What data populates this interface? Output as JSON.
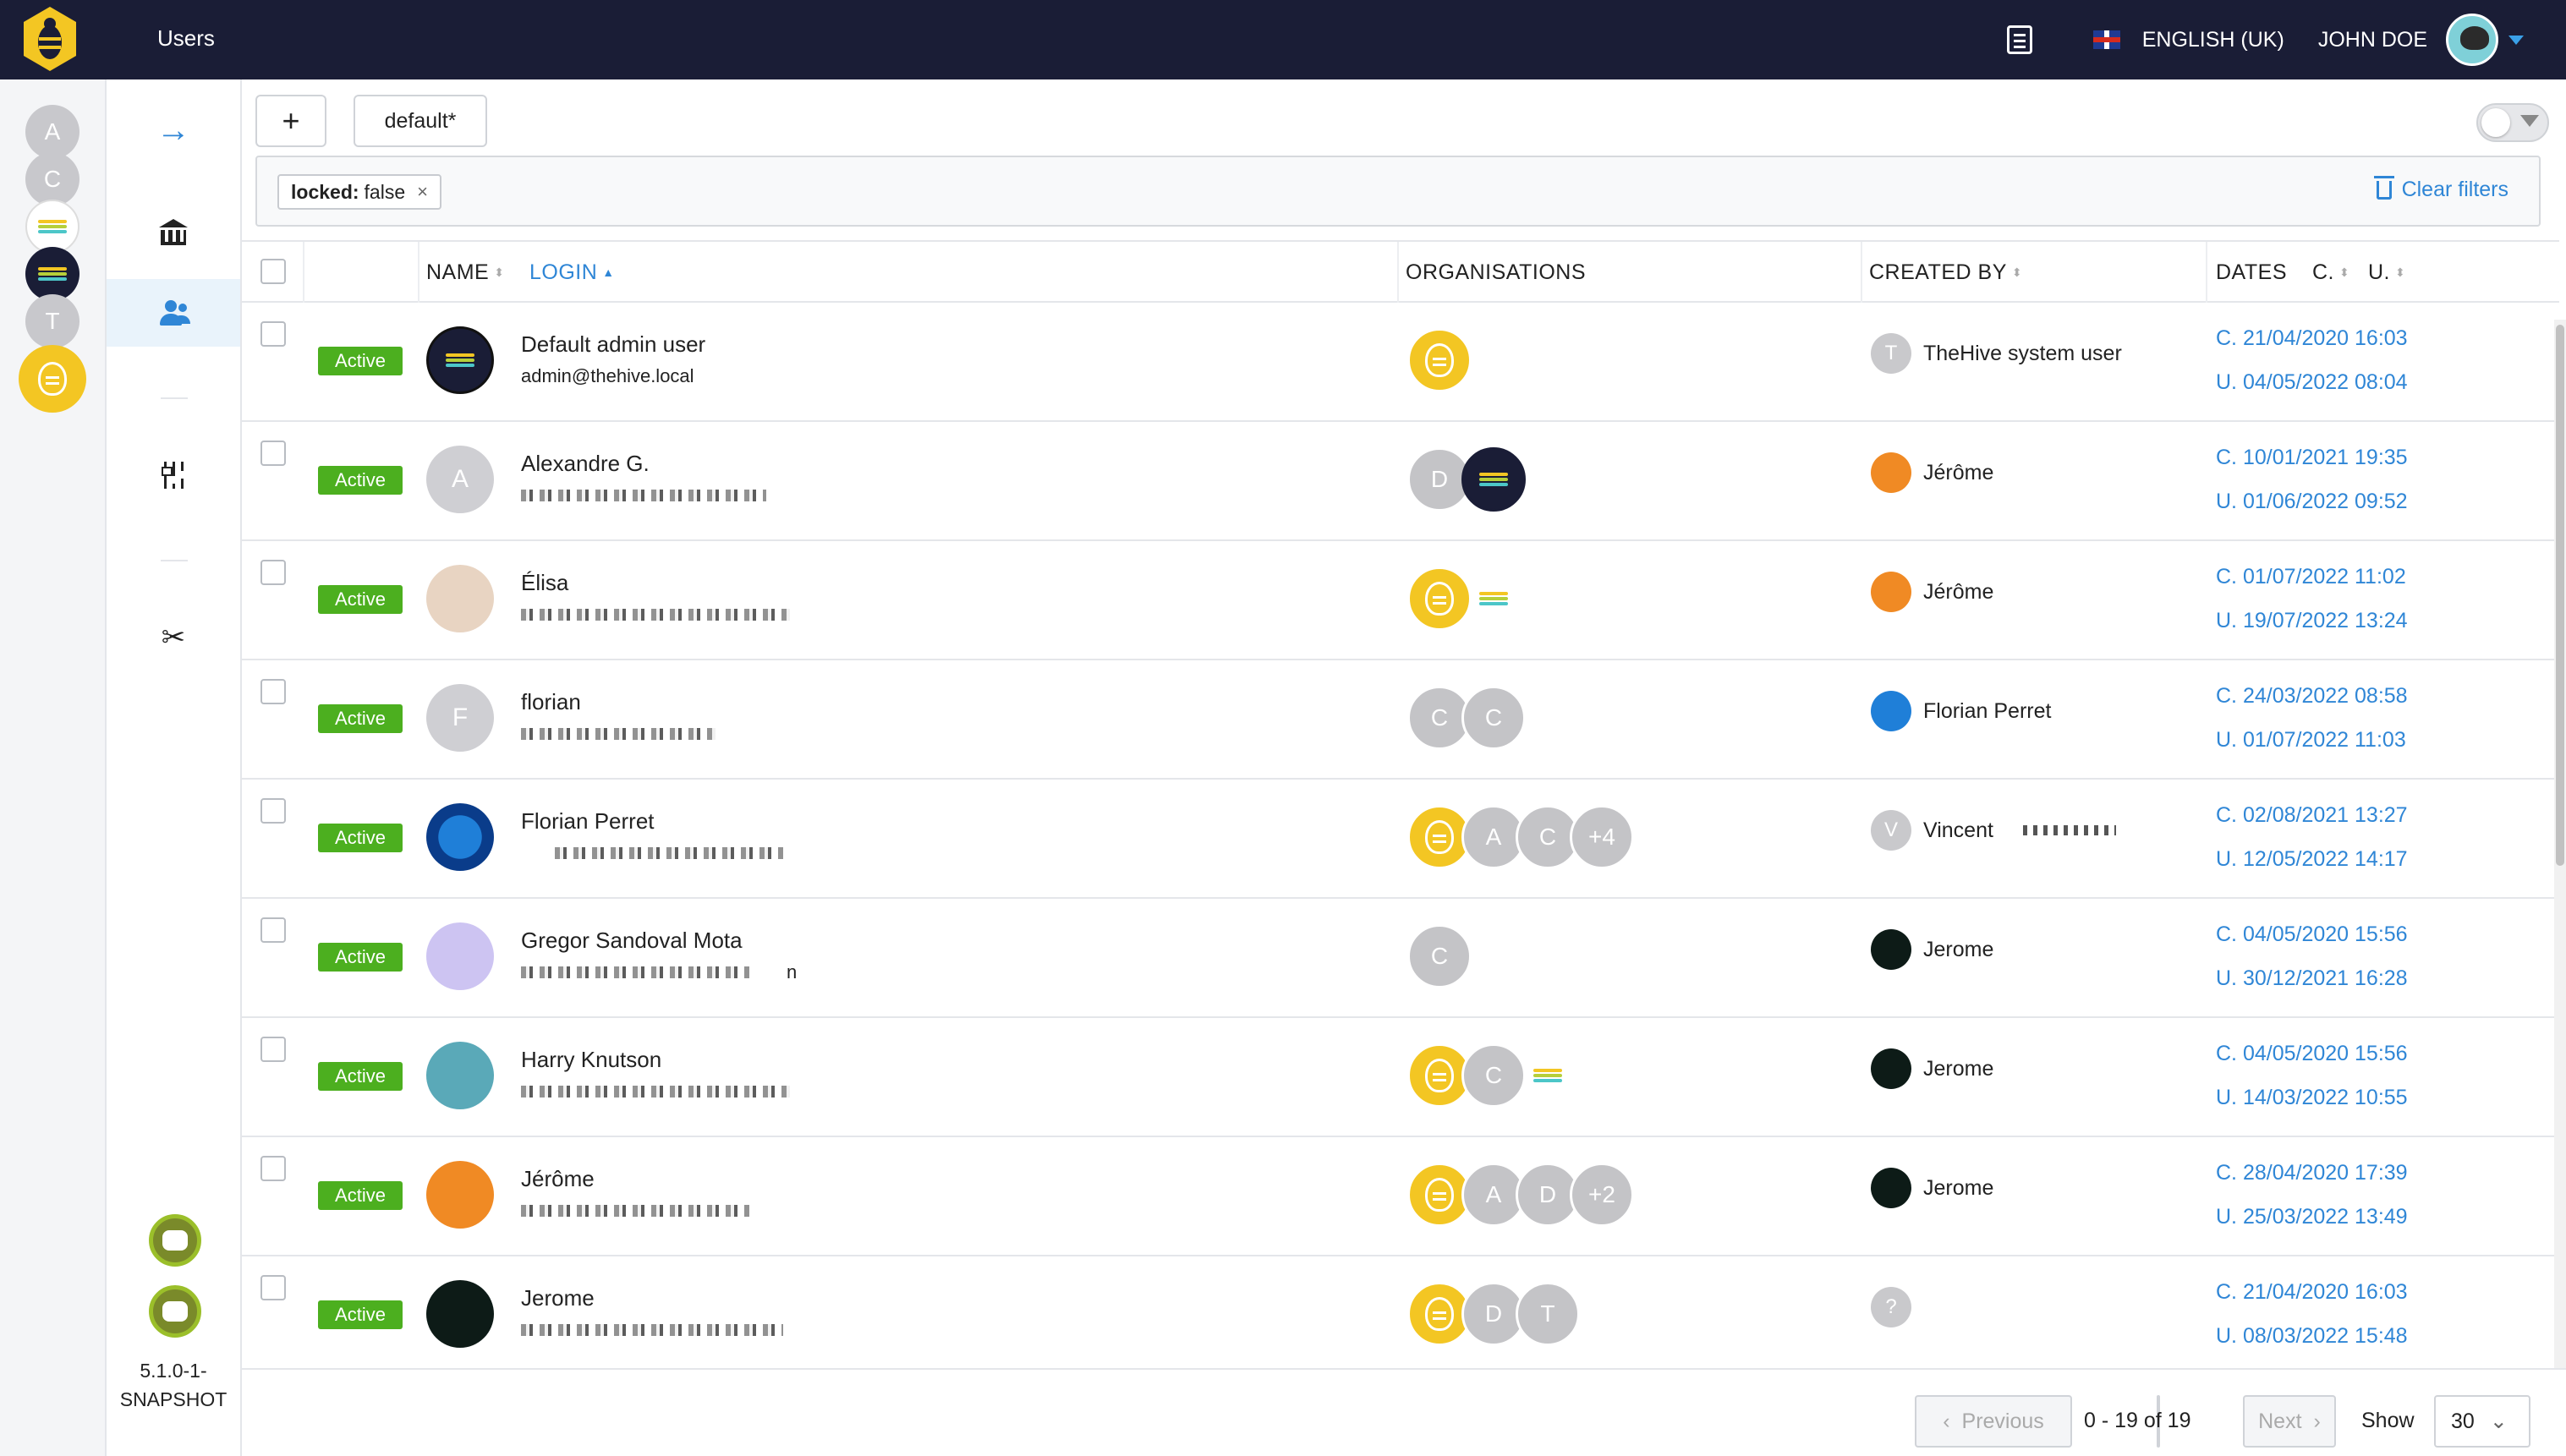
{
  "topbar": {
    "title": "Users",
    "language": "ENGLISH (UK)",
    "user": "JOHN DOE"
  },
  "rail": {
    "orgs": [
      "A",
      "C",
      "",
      "",
      "T",
      ""
    ]
  },
  "version": [
    "5.1.0-1-",
    "SNAPSHOT"
  ],
  "toolbar": {
    "add_label": "+",
    "preset_label": "default*"
  },
  "filters": {
    "chip_key": "locked:",
    "chip_value": "false",
    "clear_label": "Clear filters"
  },
  "table": {
    "headers": {
      "name": "NAME",
      "login": "LOGIN",
      "organisations": "ORGANISATIONS",
      "created_by": "CREATED BY",
      "dates": "DATES",
      "c": "C.",
      "u": "U."
    },
    "rows": [
      {
        "status": "Active",
        "avatar_letter": "",
        "name": "Default admin user",
        "login": "admin@thehive.local",
        "orgs": [
          "",
          ""
        ],
        "creator_initial": "T",
        "creator": "TheHive system user",
        "created": "C. 21/04/2020 16:03",
        "updated": "U. 04/05/2022 08:04"
      },
      {
        "status": "Active",
        "avatar_letter": "A",
        "name": "Alexandre G.",
        "login": "",
        "orgs": [
          "D",
          ""
        ],
        "creator_initial": "",
        "creator": "Jérôme",
        "created": "C. 10/01/2021 19:35",
        "updated": "U. 01/06/2022 09:52"
      },
      {
        "status": "Active",
        "avatar_letter": "",
        "name": "Élisa",
        "login": "",
        "orgs": [
          "",
          ""
        ],
        "creator_initial": "",
        "creator": "Jérôme",
        "created": "C. 01/07/2022 11:02",
        "updated": "U. 19/07/2022 13:24"
      },
      {
        "status": "Active",
        "avatar_letter": "F",
        "name": "florian",
        "login": "",
        "orgs": [
          "C",
          "C"
        ],
        "creator_initial": "",
        "creator": "Florian Perret",
        "created": "C. 24/03/2022 08:58",
        "updated": "U. 01/07/2022 11:03"
      },
      {
        "status": "Active",
        "avatar_letter": "",
        "name": "Florian Perret",
        "login": "",
        "orgs": [
          "",
          "A",
          "C",
          "+4"
        ],
        "creator_initial": "V",
        "creator": "Vincent",
        "created": "C. 02/08/2021 13:27",
        "updated": "U. 12/05/2022 14:17"
      },
      {
        "status": "Active",
        "avatar_letter": "",
        "name": "Gregor Sandoval Mota",
        "login": "n",
        "orgs": [
          "C"
        ],
        "creator_initial": "",
        "creator": "Jerome",
        "created": "C. 04/05/2020 15:56",
        "updated": "U. 30/12/2021 16:28"
      },
      {
        "status": "Active",
        "avatar_letter": "",
        "name": "Harry Knutson",
        "login": "",
        "orgs": [
          "",
          "C",
          ""
        ],
        "creator_initial": "",
        "creator": "Jerome",
        "created": "C. 04/05/2020 15:56",
        "updated": "U. 14/03/2022 10:55"
      },
      {
        "status": "Active",
        "avatar_letter": "",
        "name": "Jérôme",
        "login": "",
        "orgs": [
          "",
          "A",
          "D",
          "+2"
        ],
        "creator_initial": "",
        "creator": "Jerome",
        "created": "C. 28/04/2020 17:39",
        "updated": "U. 25/03/2022 13:49"
      },
      {
        "status": "Active",
        "avatar_letter": "",
        "name": "Jerome",
        "login": "",
        "orgs": [
          "",
          "D",
          "T"
        ],
        "creator_initial": "?",
        "creator": "",
        "created": "C. 21/04/2020 16:03",
        "updated": "U. 08/03/2022 15:48"
      }
    ]
  },
  "pagination": {
    "previous": "Previous",
    "info": "0 - 19 of 19",
    "next": "Next",
    "show_label": "Show",
    "page_size": "30"
  },
  "colors": {
    "topbar": "#1a1d36",
    "accent": "#2f86d6",
    "active_badge": "#4caf1f",
    "hive_yellow": "#f3c623"
  }
}
